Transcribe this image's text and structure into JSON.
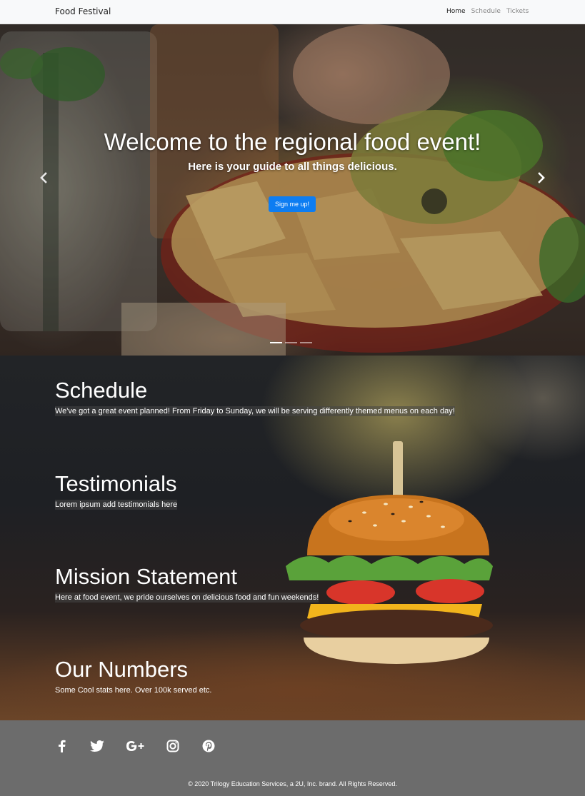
{
  "navbar": {
    "brand": "Food Festival",
    "links": [
      {
        "label": "Home",
        "active": true
      },
      {
        "label": "Schedule",
        "active": false
      },
      {
        "label": "Tickets",
        "active": false
      }
    ]
  },
  "hero": {
    "title": "Welcome to the regional food event!",
    "subtitle": "Here is your guide to all things delicious.",
    "button_label": "Sign me up!",
    "prev_icon": "chevron-left-icon",
    "next_icon": "chevron-right-icon",
    "slides_count": 3,
    "active_slide": 1
  },
  "sections": {
    "schedule": {
      "title": "Schedule",
      "text": "We've got a great event planned! From Friday to Sunday, we will be serving differently themed menus on each day!"
    },
    "testimonials": {
      "title": "Testimonials",
      "text": "Lorem ipsum add testimonials here"
    },
    "mission": {
      "title": "Mission Statement",
      "text": "Here at food event, we pride ourselves on delicious food and fun weekends!"
    },
    "numbers": {
      "title": "Our Numbers",
      "text": "Some Cool stats here. Over 100k served etc."
    }
  },
  "footer": {
    "social_icons": [
      "facebook-icon",
      "twitter-icon",
      "google-plus-icon",
      "instagram-icon",
      "pinterest-icon"
    ],
    "copyright": "© 2020 Trilogy Education Services, a 2U, Inc. brand. All Rights Reserved."
  },
  "colors": {
    "primary_button": "#0d7df2",
    "navbar_bg": "#f8f9fa",
    "footer_bg": "#6c6c6c"
  }
}
